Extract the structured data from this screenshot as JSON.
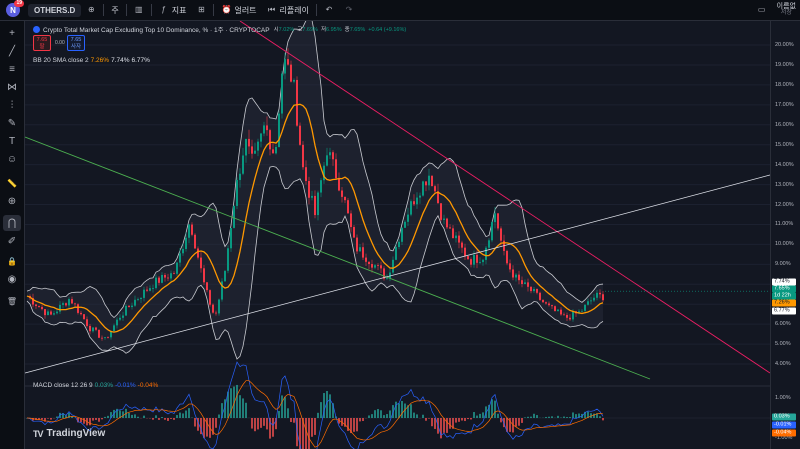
{
  "topbar": {
    "logo_letter": "N",
    "notification_count": "19",
    "symbol": "OTHERS.D",
    "interval": "주",
    "indicators_label": "지표",
    "alert_label": "얼러트",
    "replay_label": "리플레이",
    "layout_name": "이름없",
    "layout_sub": "저장"
  },
  "legend": {
    "title": "Crypto Total Market Cap Excluding Top 10 Dominance, % · 1주 · CRYPTOCAP",
    "ohlc": [
      {
        "k": "시",
        "v": "7.02%"
      },
      {
        "k": "고",
        "v": "7.69%"
      },
      {
        "k": "저",
        "v": "6.95%"
      },
      {
        "k": "종",
        "v": "7.65%"
      },
      {
        "k": "",
        "v": "+0.64 (+9.16%)"
      }
    ],
    "sell_price": "7.65",
    "sell_label": "팔",
    "spread": "0.00",
    "buy_price": "7.65",
    "buy_label": "사자",
    "bb_name": "BB 20 SMA close 2",
    "bb_values": [
      "7.26%",
      "7.74%",
      "6.77%"
    ],
    "macd_name": "MACD close 12 26 9",
    "macd_values": [
      "0.03%",
      "-0.01%",
      "-0.04%"
    ]
  },
  "branding": {
    "tv": "TradingView",
    "tv_mark": "TV"
  },
  "price_axis": {
    "ticks": [
      "20.00%",
      "19.00%",
      "18.00%",
      "17.00%",
      "16.00%",
      "15.00%",
      "14.00%",
      "13.00%",
      "12.00%",
      "11.00%",
      "10.00%",
      "9.00%",
      "8.00%",
      "7.00%",
      "6.00%",
      "5.00%",
      "4.00%"
    ],
    "labels": [
      {
        "text": "7.74%",
        "value": 7.74,
        "bg": "#ffffff",
        "fg": "#131722"
      },
      {
        "text": "7.65%",
        "value": 7.65,
        "bg": "#089981",
        "fg": "#ffffff"
      },
      {
        "text": "1d 22h",
        "value": 7.45,
        "bg": "#089981",
        "fg": "#ffffff"
      },
      {
        "text": "7.26%",
        "value": 7.26,
        "bg": "#ff9800",
        "fg": "#131722"
      },
      {
        "text": "6.77%",
        "value": 6.77,
        "bg": "#ffffff",
        "fg": "#131722"
      }
    ],
    "macd_ticks": [
      "1.00%",
      "-1.00%"
    ],
    "macd_labels": [
      {
        "text": "0.03%",
        "bg": "#26a69a",
        "fg": "#ffffff"
      },
      {
        "text": "-0.01%",
        "bg": "#2962ff",
        "fg": "#ffffff"
      },
      {
        "text": "-0.04%",
        "bg": "#ff6d00",
        "fg": "#ffffff"
      }
    ]
  },
  "colors": {
    "up": "#089981",
    "down": "#f23645",
    "bb_band": "#c9cbd1",
    "bb_basis": "#ff9800",
    "trend_pink": "#e91e63",
    "trend_green": "#4caf50",
    "trend_white": "#e0e3eb",
    "macd_line": "#2962ff",
    "signal_line": "#ff6d00"
  },
  "left_toolbar_icons": [
    "crosshair-icon",
    "trend-line-icon",
    "fib-icon",
    "pattern-icon",
    "projection-icon",
    "brush-icon",
    "text-icon",
    "emoji-icon",
    "ruler-icon",
    "zoom-in-icon",
    "magnet-icon",
    "lock-drawings-icon",
    "lock-icon",
    "eye-icon",
    "trash-icon"
  ]
}
